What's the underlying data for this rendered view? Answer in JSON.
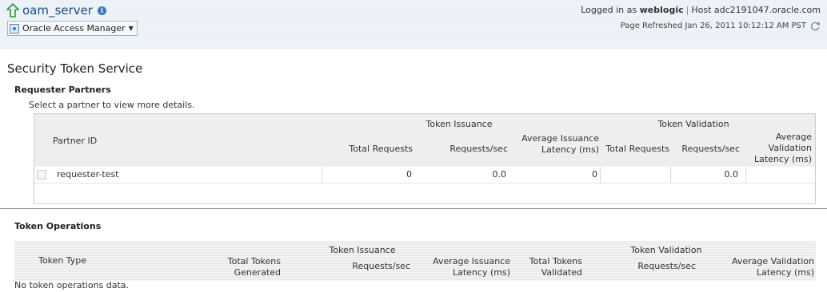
{
  "header": {
    "server_name": "oam_server",
    "info_symbol": "i",
    "target_menu_label": "Oracle Access Manager",
    "logged_in_prefix": "Logged in as",
    "user": "weblogic",
    "host_label": "Host adc2191047.oracle.com",
    "page_refreshed": "Page Refreshed Jan 26, 2011 10:12:12 AM PST"
  },
  "page_title": "Security Token Service",
  "requester_partners": {
    "heading": "Requester Partners",
    "hint": "Select a partner to view more details.",
    "group_headers": {
      "issuance": "Token Issuance",
      "validation": "Token Validation"
    },
    "columns": {
      "partner_id": "Partner ID",
      "total_requests": "Total Requests",
      "requests_sec": "Requests/sec",
      "avg_issuance_l1": "Average Issuance",
      "avg_issuance_l2": "Latency (ms)",
      "val_total_requests": "Total Requests",
      "val_requests_sec": "Requests/sec",
      "avg_validation_l1": "Average",
      "avg_validation_l2": "Validation",
      "avg_validation_l3": "Latency (ms)"
    },
    "rows": [
      {
        "partner_id": "requester-test",
        "total_requests": "0",
        "requests_sec": "0.0",
        "avg_latency": "0",
        "val_total_requests": "",
        "val_requests_sec": "0.0",
        "val_avg_latency": ""
      }
    ]
  },
  "token_operations": {
    "heading": "Token Operations",
    "group_headers": {
      "issuance": "Token Issuance",
      "validation": "Token Validation"
    },
    "columns": {
      "token_type": "Token Type",
      "total_generated_l1": "Total Tokens",
      "total_generated_l2": "Generated",
      "requests_sec": "Requests/sec",
      "avg_issuance_l1": "Average Issuance",
      "avg_issuance_l2": "Latency (ms)",
      "total_validated_l1": "Total Tokens",
      "total_validated_l2": "Validated",
      "val_requests_sec": "Requests/sec",
      "avg_validation_l1": "Average Validation",
      "avg_validation_l2": "Latency (ms)"
    },
    "empty_message": "No token operations data."
  }
}
